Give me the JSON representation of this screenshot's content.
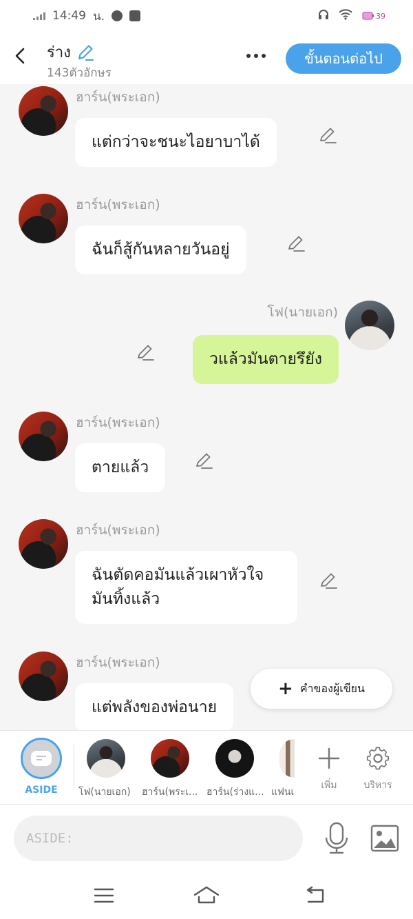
{
  "status_bar": {
    "time": "14:49",
    "carrier_suffix": "น.",
    "battery": "39"
  },
  "header": {
    "title": "ร่าง",
    "char_count": "143ตัวอักษร",
    "next_label": "ขั้นตอนต่อไป"
  },
  "messages": [
    {
      "sender": "ฮาร์น(พระเอก)",
      "text": "แต่กว่าจะชนะไอยาบาได้",
      "side": "left"
    },
    {
      "sender": "ฮาร์น(พระเอก)",
      "text": "ฉันก็สู้กันหลายวันอยู่",
      "side": "left"
    },
    {
      "sender": "โฟ(นายเอก)",
      "text": "วแล้วมันตายรึยัง",
      "side": "right"
    },
    {
      "sender": "ฮาร์น(พระเอก)",
      "text": "ตายแล้ว",
      "side": "left"
    },
    {
      "sender": "ฮาร์น(พระเอก)",
      "text": "ฉันตัดคอมันแล้วเผาหัวใจมันทิ้งแล้ว",
      "side": "left"
    },
    {
      "sender": "ฮาร์น(พระเอก)",
      "text": "แต่พลังของพ่อนาย",
      "side": "left"
    }
  ],
  "writer_button": {
    "label": "คำของผู้เขียน"
  },
  "character_bar": {
    "aside_label": "ASIDE",
    "characters": [
      {
        "label": "โฟ(นายเอก)"
      },
      {
        "label": "ฮาร์น(พระเ..."
      },
      {
        "label": "ฮาร์น(ร่างแ..."
      },
      {
        "label": "แฟนเ"
      }
    ],
    "add_label": "เพิ่ม",
    "manage_label": "บริหาร"
  },
  "input": {
    "placeholder": "ASIDE:"
  },
  "colors": {
    "accent": "#4aa3ea",
    "green_bubble": "#d5f598",
    "background": "#f5f5f5"
  },
  "icons": [
    "back-icon",
    "pencil-icon",
    "more-icon",
    "plus-icon",
    "gear-icon",
    "mic-icon",
    "image-icon",
    "menu-icon",
    "home-icon",
    "return-icon"
  ]
}
